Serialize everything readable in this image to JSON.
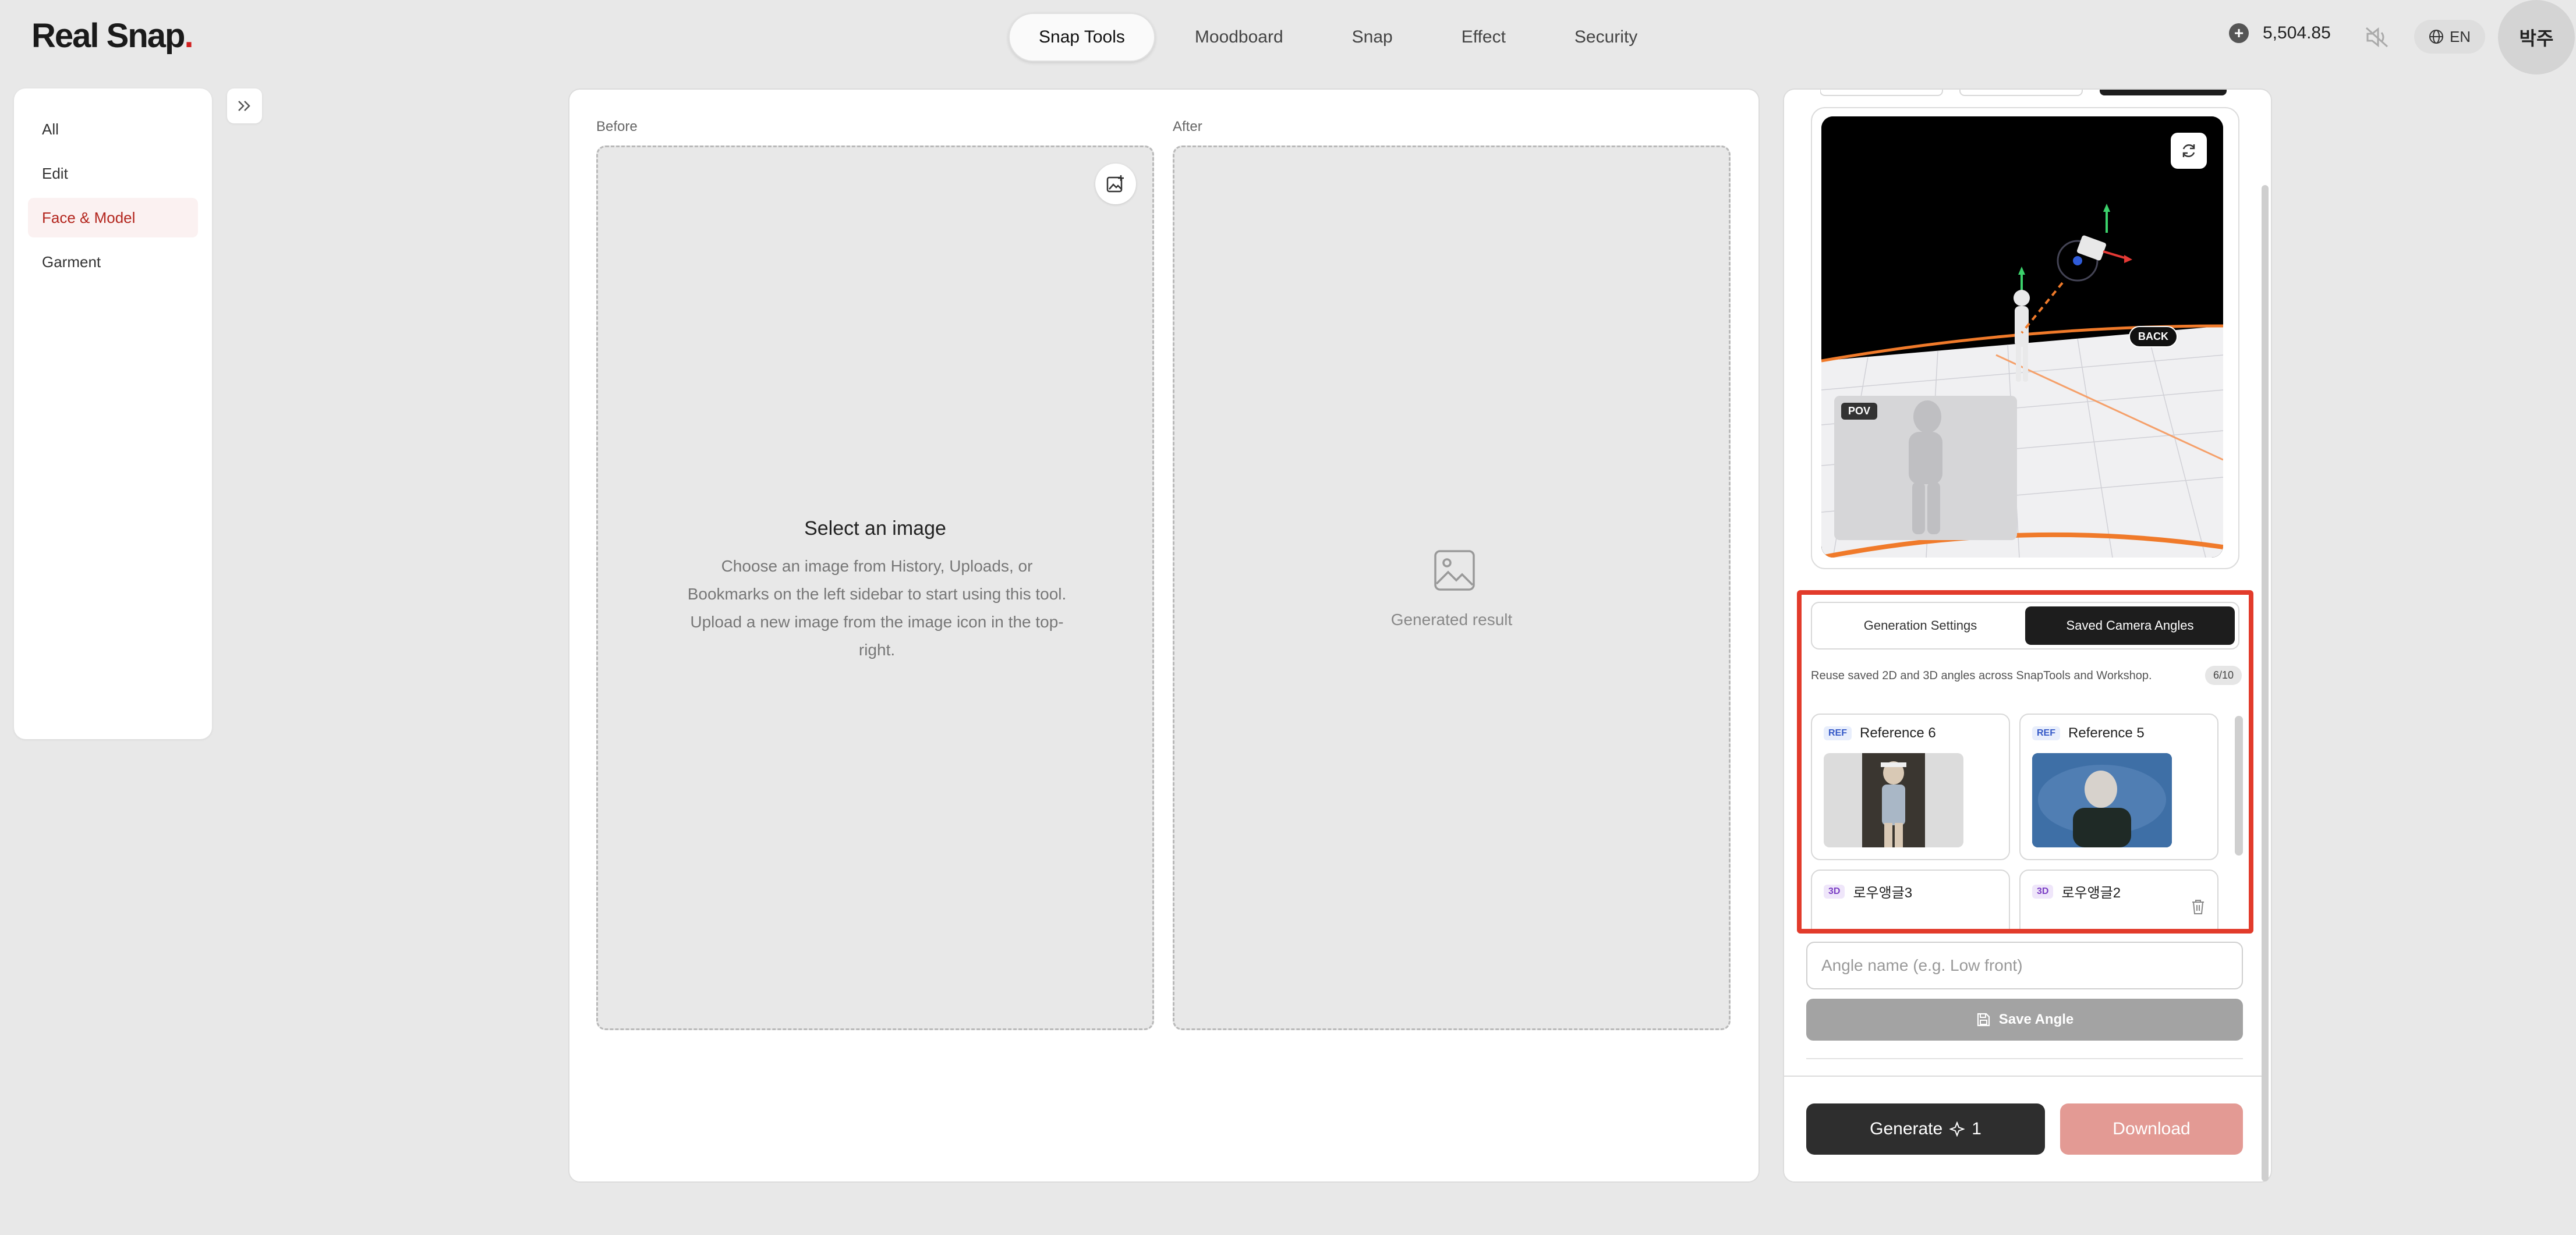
{
  "app": {
    "logo_text": "Real Snap",
    "logo_dot": "."
  },
  "nav": {
    "tabs": [
      {
        "label": "Snap Tools",
        "active": true
      },
      {
        "label": "Moodboard",
        "active": false
      },
      {
        "label": "Snap",
        "active": false
      },
      {
        "label": "Effect",
        "active": false
      },
      {
        "label": "Security",
        "active": false
      }
    ]
  },
  "header": {
    "credits": "5,504.85",
    "language": "EN",
    "user_initials": "박주"
  },
  "sidebar": {
    "items": [
      {
        "label": "All",
        "active": false
      },
      {
        "label": "Edit",
        "active": false
      },
      {
        "label": "Face & Model",
        "active": true
      },
      {
        "label": "Garment",
        "active": false
      }
    ]
  },
  "main": {
    "before_label": "Before",
    "after_label": "After",
    "select_title": "Select an image",
    "select_desc": "Choose an image from History, Uploads, or Bookmarks on the left sidebar to start using this tool. Upload a new image from the image icon in the top-right.",
    "generated_placeholder": "Generated result"
  },
  "camera": {
    "back_badge": "BACK",
    "pov_badge": "POV"
  },
  "angles": {
    "tabs": [
      {
        "label": "Generation Settings",
        "active": false
      },
      {
        "label": "Saved Camera Angles",
        "active": true
      }
    ],
    "hint": "Reuse saved 2D and 3D angles across SnapTools and Workshop.",
    "count": "6/10",
    "cards": [
      {
        "tag": "REF",
        "name": "Reference 6"
      },
      {
        "tag": "REF",
        "name": "Reference 5"
      },
      {
        "tag": "3D",
        "name": "로우앵글3"
      },
      {
        "tag": "3D",
        "name": "로우앵글2"
      }
    ],
    "name_placeholder": "Angle name (e.g. Low front)",
    "save_label": "Save Angle"
  },
  "actions": {
    "generate_label": "Generate",
    "generate_cost": "1",
    "download_label": "Download"
  },
  "colors": {
    "accent": "#d11f1f",
    "highlight_border": "#e23b2b",
    "download_bg": "#e39a94",
    "generate_bg": "#2e2e2e"
  }
}
